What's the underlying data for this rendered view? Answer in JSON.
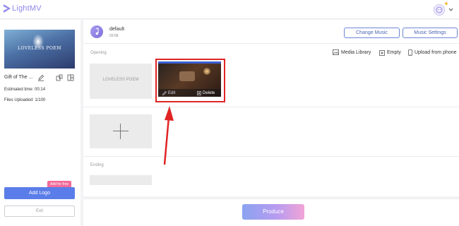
{
  "app": {
    "name": "LightMV"
  },
  "header": {
    "avatar_icon": "user-avatar-icon",
    "menu_icon": "chevron-down-icon"
  },
  "sidebar": {
    "thumbnail_text": "LOVELESS POEM",
    "theme_name": "Gift of The ...",
    "estimated_time": "Estimated time: 00:14",
    "files_uploaded": "Files Uploaded: 1/100",
    "add_for_free_badge": "Add for free",
    "add_logo_label": "Add Logo",
    "exit_label": "Exit"
  },
  "music": {
    "name": "default",
    "duration": "03:58",
    "change_music_label": "Change Music",
    "music_settings_label": "Music Settings"
  },
  "timeline": {
    "opening_label": "Opening",
    "ending_label": "Ending",
    "opening_placeholder_text": "LOVELESS POEM",
    "tools": {
      "media_library": "Media Library",
      "empty": "Empty",
      "upload_from_phone": "Upload from phone"
    },
    "clip": {
      "edit_label": "Edit",
      "delete_label": "Delete"
    }
  },
  "footer": {
    "produce_label": "Produce"
  },
  "colors": {
    "accent": "#5b7de9",
    "brand": "#8f86e8",
    "highlight_box": "#e02424",
    "annotation_arrow": "#e02424",
    "badge": "#f36b9b"
  }
}
